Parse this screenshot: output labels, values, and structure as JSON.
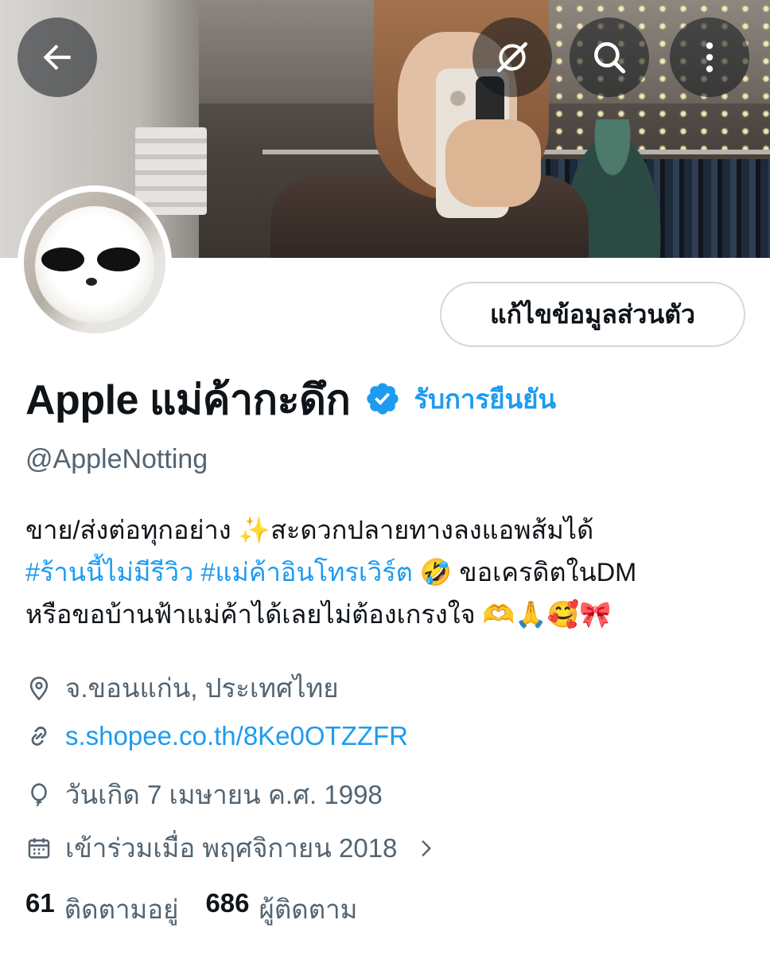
{
  "header": {
    "back_icon": "arrow-left-icon",
    "grok_icon": "grok-icon",
    "search_icon": "search-icon",
    "more_icon": "more-vertical-icon"
  },
  "profile": {
    "edit_button_label": "แก้ไขข้อมูลส่วนตัว",
    "display_name": "Apple แม่ค้ากะดึก",
    "verified_icon": "verified-badge-icon",
    "get_verified_label": "รับการยืนยัน",
    "handle": "@AppleNotting",
    "bio": {
      "line1_text": "ขาย/ส่งต่อทุกอย่าง ✨สะดวกปลายทางลงแอพส้มได้",
      "hashtag1": "#ร้านนี้ไม่มีรีวิว",
      "hashtag2": "#แม่ค้าอินโทรเวิร์ต",
      "line2_tail": " 🤣 ขอเครดิตในDM",
      "line3_text": "หรือขอบ้านฟ้าแม่ค้าได้เลยไม่ต้องเกรงใจ 🫶🙏🥰🎀"
    },
    "location": "จ.ขอนแก่น, ประเทศไทย",
    "website": "s.shopee.co.th/8Ke0OTZZFR",
    "birthday": "วันเกิด 7 เมษายน ค.ศ. 1998",
    "joined": "เข้าร่วมเมื่อ พฤศจิกายน 2018",
    "following_count": "61",
    "following_label": "ติดตามอยู่",
    "followers_count": "686",
    "followers_label": "ผู้ติดตาม"
  },
  "colors": {
    "accent": "#1d9bf0",
    "secondary_text": "#536471",
    "primary_text": "#0f1419"
  }
}
